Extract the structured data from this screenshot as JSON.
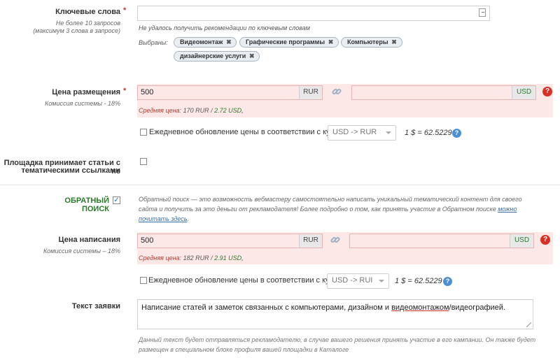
{
  "keywords": {
    "label": "Ключевые слова",
    "required_mark": "*",
    "note_line1": "Не более 10 запросов",
    "note_line2": "(максимум 3 слова в запросе)",
    "input_value": "",
    "error_text": "Не удалось получить рекомендации по ключевым словам",
    "selected_label": "Выбраны:",
    "tags": [
      "Видеомонтаж",
      "Графические программы",
      "Компьютеры",
      "дизайнерские услуги"
    ],
    "tag_remove_glyph": "✖"
  },
  "placement_price": {
    "label": "Цена размещения",
    "required_mark": "*",
    "commission": "Комиссия системы - 18%",
    "rub_value": "500",
    "rub_currency": "RUR",
    "usd_value": "",
    "usd_currency": "USD",
    "help_glyph": "?",
    "avg_label": "Средняя цена:",
    "avg_rub": "170 RUR",
    "avg_sep": " / ",
    "avg_usd": "2.72 USD",
    "avg_end": ",",
    "daily_update_label": "Ежедневное обновление цены в соответствии с курсом",
    "rate_select": "USD -> RUR",
    "rate_text": "1 $ = 62.5229 ₽"
  },
  "non_thematic": {
    "label_line1": "Площадка принимает статьи с не",
    "label_line2": "тематическими ссылками"
  },
  "reverse_search": {
    "label": "ОБРАТНЫЙ ПОИСК",
    "checked": true,
    "checkmark": "✓",
    "desc_part1": "Обратный поиск — это возможность вебмастеру самостоятельно написать уникальный тематический контент для своего",
    "desc_part2": "сайта и получить за это деньги от рекламодателя! Более подробно о том, как принять участие в Обратном поиске ",
    "desc_link": "можно почитать здесь",
    "desc_end": "."
  },
  "writing_price": {
    "label": "Цена написания",
    "commission": "Комиссия системы – 18%",
    "rub_value": "500",
    "rub_currency": "RUR",
    "usd_value": "",
    "usd_currency": "USD",
    "help_glyph": "?",
    "avg_label": "Средняя цена:",
    "avg_rub": "182 RUR",
    "avg_sep": " / ",
    "avg_usd": "2.91 USD",
    "avg_end": ",",
    "daily_update_label": "Ежедневное обновление цены в соответствии с курсом",
    "rate_select": "USD -> RUI",
    "rate_text": "1 $ = 62.5229 ₽"
  },
  "application_text": {
    "label": "Текст заявки",
    "value_pre": "Написание статей и заметок связанных с компьютерами, дизайном и ",
    "value_underlined": "видеомонтажом",
    "value_post": "/видеографией.",
    "hint_line1": "Данный текст будет отправляться рекламодателю, в случае вашего решения принять участие в его кампании. Он также будет",
    "hint_line2": "размещен в специальном блоке профиля вашей площадки в Каталоге"
  },
  "icons": {
    "link": "chain-link-icon",
    "help": "question-icon",
    "error_help": "error-question-icon",
    "resize": "resize-grip-icon",
    "dropdown": "chevron-down-icon"
  }
}
